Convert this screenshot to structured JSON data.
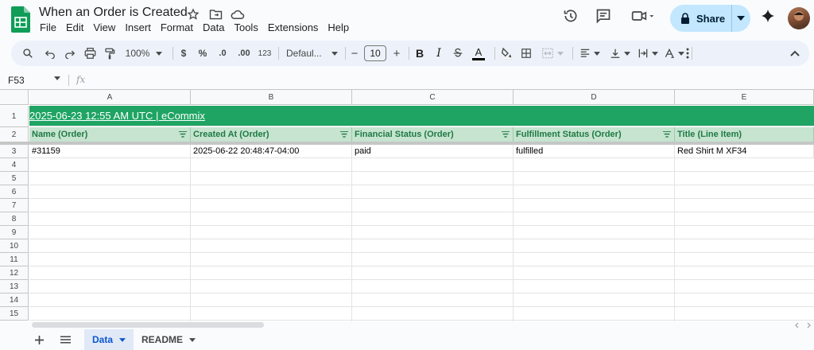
{
  "doc": {
    "title": "When an Order is Created",
    "menus": [
      "File",
      "Edit",
      "View",
      "Insert",
      "Format",
      "Data",
      "Tools",
      "Extensions",
      "Help"
    ]
  },
  "share": {
    "label": "Share"
  },
  "toolbar": {
    "zoom": "100%",
    "currency": "$",
    "percent": "%",
    "decrease_decimal": ".0",
    "increase_decimal": ".00",
    "more_formats": "123",
    "font": "Defaul...",
    "font_size": "10",
    "minus": "−",
    "plus": "+",
    "bold": "B",
    "italic": "I",
    "text_color": "A"
  },
  "formula_bar": {
    "cell_ref": "F53",
    "fx": "fx",
    "value": ""
  },
  "columns": [
    "A",
    "B",
    "C",
    "D",
    "E"
  ],
  "rows": [
    "1",
    "2",
    "3",
    "4",
    "5",
    "6",
    "7",
    "8",
    "9",
    "10",
    "11",
    "12",
    "13",
    "14",
    "15"
  ],
  "row1": {
    "text": "2025-06-23 12:55 AM UTC | eCommix"
  },
  "headers": [
    "Name (Order)",
    "Created At (Order)",
    "Financial Status (Order)",
    "Fulfillment Status (Order)",
    "Title (Line Item)"
  ],
  "data_rows": [
    [
      "#31159",
      "2025-06-22 20:48:47-04:00",
      "paid",
      "fulfilled",
      "Red Shirt M XF34"
    ]
  ],
  "sheets": [
    {
      "label": "Data",
      "active": true
    },
    {
      "label": "README",
      "active": false
    }
  ],
  "colors": {
    "brand_green": "#1fa463",
    "header_green": "#c6e4d0",
    "share_blue": "#c2e7ff",
    "active_tab": "#0b57d0"
  }
}
